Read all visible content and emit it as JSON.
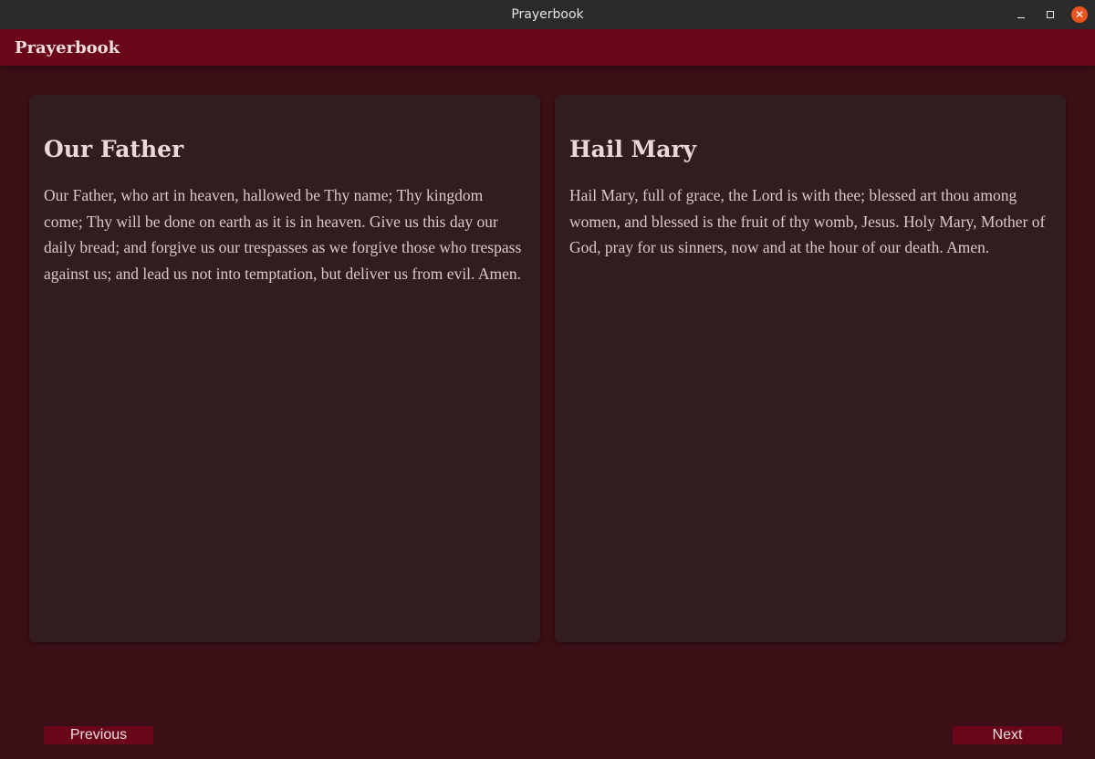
{
  "window": {
    "title": "Prayerbook",
    "controls": {
      "minimize": "minimize-icon",
      "maximize": "maximize-icon",
      "close": "close-icon"
    }
  },
  "appbar": {
    "title": "Prayerbook"
  },
  "prayers": [
    {
      "title": "Our Father",
      "text": "Our Father, who art in heaven, hallowed be Thy name; Thy kingdom come; Thy will be done on earth as it is in heaven. Give us this day our daily bread; and forgive us our trespasses as we forgive those who trespass against us; and lead us not into temptation, but deliver us from evil. Amen."
    },
    {
      "title": "Hail Mary",
      "text": "Hail Mary, full of grace, the Lord is with thee; blessed art thou among women, and blessed is the fruit of thy womb, Jesus. Holy Mary, Mother of God, pray for us sinners, now and at the hour of our death. Amen."
    }
  ],
  "navigation": {
    "previous_label": "Previous",
    "next_label": "Next"
  },
  "colors": {
    "accent": "#6a0619",
    "background": "#3b0f16",
    "card": "#311c1f",
    "close_button": "#e95420"
  }
}
